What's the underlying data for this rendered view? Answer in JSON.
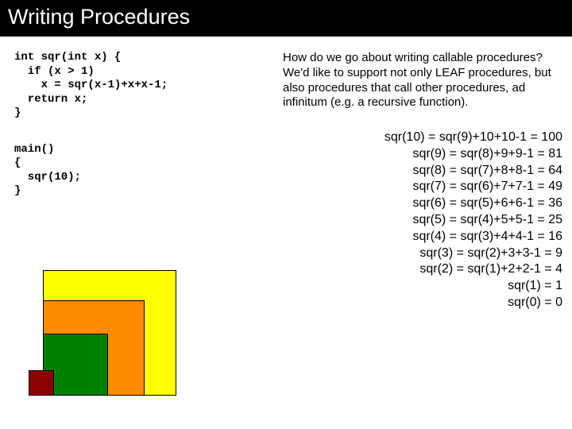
{
  "title": "Writing Procedures",
  "code1": "int sqr(int x) {\n  if (x > 1)\n    x = sqr(x-1)+x+x-1;\n  return x;\n}",
  "code2": "main()\n{\n  sqr(10);\n}",
  "paragraph": "How do we go about writing callable procedures? We'd like to support not only LEAF procedures, but also procedures that call other procedures, ad infinitum (e.g. a recursive function).",
  "trace": [
    "sqr(10) = sqr(9)+10+10-1 = 100",
    "sqr(9) = sqr(8)+9+9-1 = 81",
    "sqr(8) = sqr(7)+8+8-1 = 64",
    "sqr(7) = sqr(6)+7+7-1 = 49",
    "sqr(6) = sqr(5)+6+6-1 = 36",
    "sqr(5) = sqr(4)+5+5-1 = 25",
    "sqr(4) = sqr(3)+4+4-1 = 16",
    "sqr(3) = sqr(2)+3+3-1 = 9",
    "sqr(2) = sqr(1)+2+2-1 = 4",
    "sqr(1) = 1",
    "sqr(0) = 0"
  ]
}
